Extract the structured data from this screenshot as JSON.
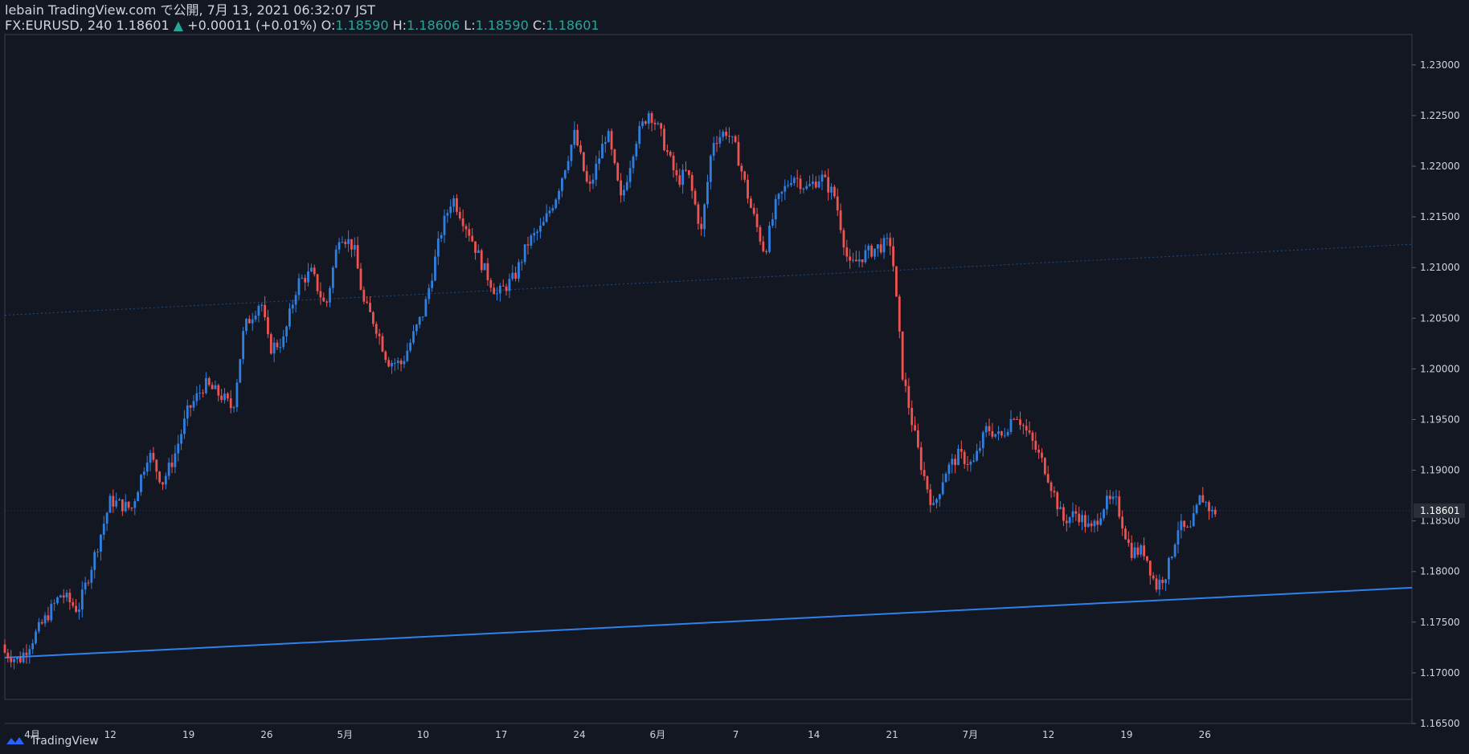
{
  "header": {
    "line1": "lebain TradingView.com で公開, 7月 13, 2021 06:32:07 JST",
    "symbol": "FX:EURUSD, 240",
    "last": "1.18601",
    "change_arrow": "▲",
    "change": "+0.00011 (+0.01%)",
    "o_label": "O:",
    "o_value": "1.18590",
    "h_label": "H:",
    "h_value": "1.18606",
    "l_label": "L:",
    "l_value": "1.18590",
    "c_label": "C:",
    "c_value": "1.18601"
  },
  "footer": {
    "brand": "TradingView",
    "icon": "tradingview-logo-icon"
  },
  "colors": {
    "background": "#131722",
    "up": "#2f7fe0",
    "down": "#ef5350",
    "trendline": "#2f80ed",
    "text": "#d1d4dc",
    "change_up": "#26a69a"
  },
  "chart_data": {
    "type": "candlestick",
    "symbol": "FX:EURUSD",
    "timeframe": "240",
    "ylim": [
      1.165,
      1.233
    ],
    "y_ticks": [
      "1.23000",
      "1.22500",
      "1.22000",
      "1.21500",
      "1.21000",
      "1.20500",
      "1.20000",
      "1.19500",
      "1.19000",
      "1.18500",
      "1.18000",
      "1.17500",
      "1.17000",
      "1.16500"
    ],
    "x_ticks": [
      "4月",
      "12",
      "19",
      "26",
      "5月",
      "10",
      "17",
      "24",
      "6月",
      "7",
      "14",
      "21",
      "7月",
      "12",
      "19",
      "26"
    ],
    "last_price_label": "1.18601",
    "last_price": 1.18601,
    "close_path": [
      [
        0,
        1.172
      ],
      [
        10,
        1.1712
      ],
      [
        25,
        1.1745
      ],
      [
        40,
        1.1778
      ],
      [
        52,
        1.1762
      ],
      [
        63,
        1.1812
      ],
      [
        75,
        1.187
      ],
      [
        90,
        1.1862
      ],
      [
        102,
        1.1918
      ],
      [
        112,
        1.1888
      ],
      [
        120,
        1.1912
      ],
      [
        130,
        1.1958
      ],
      [
        142,
        1.1985
      ],
      [
        155,
        1.1972
      ],
      [
        162,
        1.196
      ],
      [
        170,
        1.204
      ],
      [
        182,
        1.2068
      ],
      [
        188,
        1.202
      ],
      [
        198,
        1.2028
      ],
      [
        208,
        1.2085
      ],
      [
        218,
        1.2095
      ],
      [
        228,
        1.206
      ],
      [
        238,
        1.2135
      ],
      [
        248,
        1.212
      ],
      [
        255,
        1.2065
      ],
      [
        263,
        1.2045
      ],
      [
        272,
        1.2008
      ],
      [
        282,
        1.2005
      ],
      [
        290,
        1.2032
      ],
      [
        298,
        1.2058
      ],
      [
        310,
        1.2135
      ],
      [
        318,
        1.217
      ],
      [
        330,
        1.2135
      ],
      [
        340,
        1.21
      ],
      [
        350,
        1.2073
      ],
      [
        362,
        1.209
      ],
      [
        372,
        1.2125
      ],
      [
        382,
        1.214
      ],
      [
        392,
        1.2172
      ],
      [
        405,
        1.2232
      ],
      [
        415,
        1.2175
      ],
      [
        428,
        1.2235
      ],
      [
        438,
        1.2165
      ],
      [
        448,
        1.2225
      ],
      [
        458,
        1.2255
      ],
      [
        466,
        1.2232
      ],
      [
        478,
        1.2185
      ],
      [
        485,
        1.2195
      ],
      [
        495,
        1.2135
      ],
      [
        503,
        1.2225
      ],
      [
        513,
        1.2235
      ],
      [
        520,
        1.2215
      ],
      [
        530,
        1.216
      ],
      [
        540,
        1.2115
      ],
      [
        548,
        1.2162
      ],
      [
        560,
        1.2192
      ],
      [
        570,
        1.2178
      ],
      [
        580,
        1.219
      ],
      [
        590,
        1.217
      ],
      [
        600,
        1.21
      ],
      [
        610,
        1.2112
      ],
      [
        620,
        1.212
      ],
      [
        630,
        1.2125
      ],
      [
        638,
        1.1995
      ],
      [
        645,
        1.1945
      ],
      [
        652,
        1.19
      ],
      [
        660,
        1.1862
      ],
      [
        668,
        1.1898
      ],
      [
        678,
        1.1915
      ],
      [
        688,
        1.1905
      ],
      [
        698,
        1.1942
      ],
      [
        708,
        1.1932
      ],
      [
        718,
        1.1958
      ],
      [
        730,
        1.1928
      ],
      [
        740,
        1.19
      ],
      [
        752,
        1.185
      ],
      [
        762,
        1.1858
      ],
      [
        772,
        1.184
      ],
      [
        782,
        1.1868
      ],
      [
        790,
        1.1868
      ],
      [
        800,
        1.182
      ],
      [
        810,
        1.182
      ],
      [
        818,
        1.1785
      ],
      [
        826,
        1.18
      ],
      [
        834,
        1.1845
      ],
      [
        842,
        1.1838
      ],
      [
        850,
        1.1875
      ],
      [
        858,
        1.1858
      ],
      [
        862,
        1.18601
      ]
    ],
    "trendlines": [
      {
        "name": "support",
        "style": "solid",
        "from": [
          0,
          1.1715
        ],
        "to": [
          1000,
          1.1784
        ]
      },
      {
        "name": "upper",
        "style": "dotted",
        "from": [
          0,
          1.2053
        ],
        "to": [
          1000,
          1.2123
        ]
      }
    ]
  }
}
